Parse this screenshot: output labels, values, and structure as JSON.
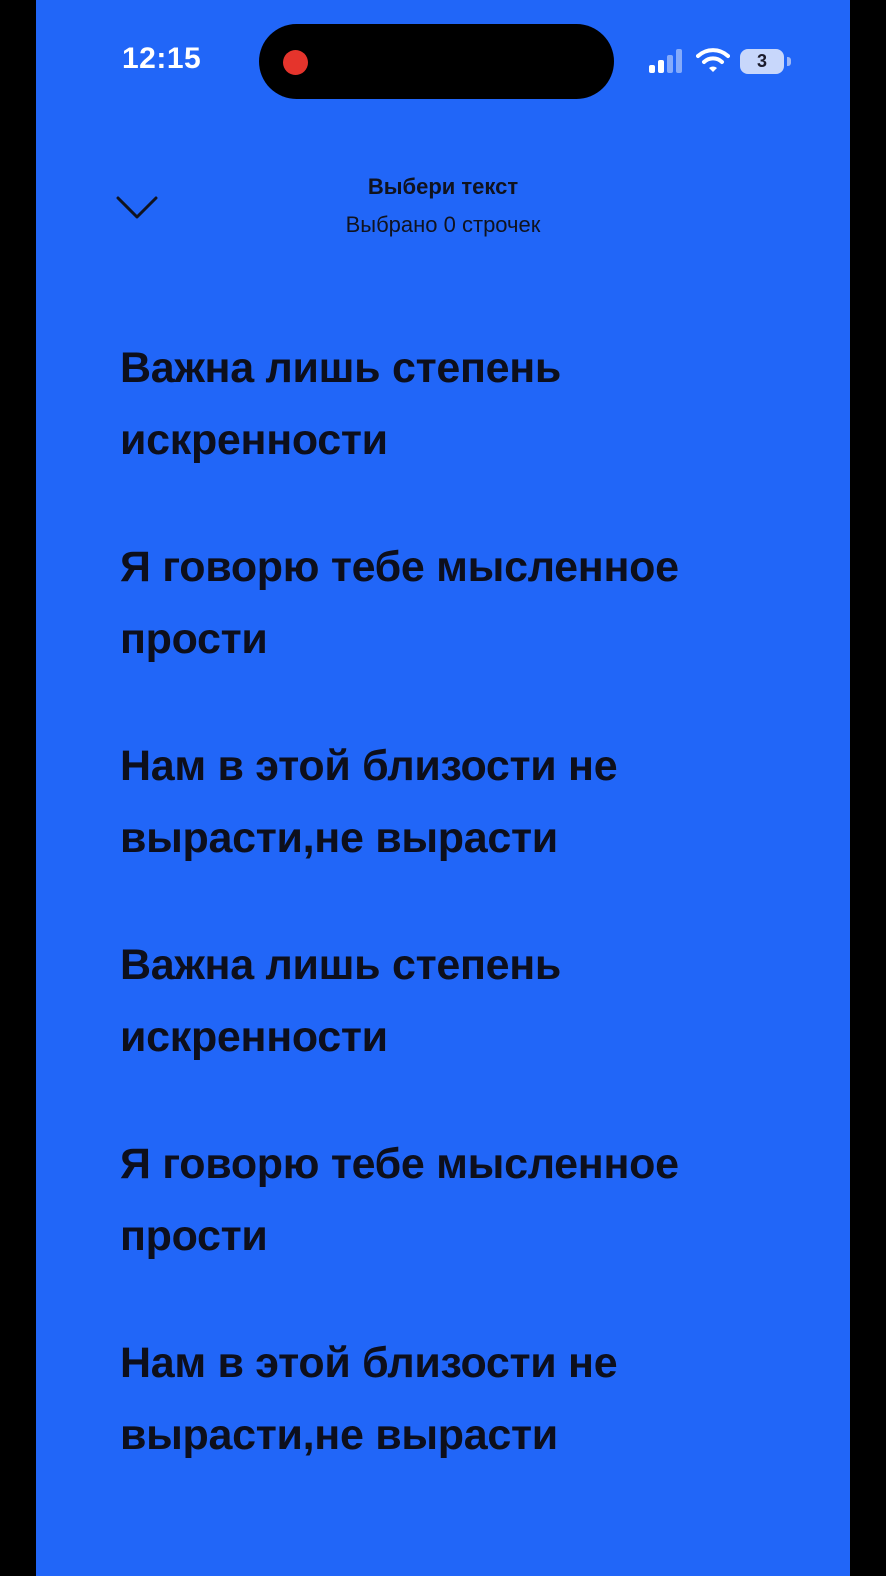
{
  "status_bar": {
    "time": "12:15",
    "battery_level": "3",
    "icons": [
      "recording-indicator-icon",
      "cellular-signal-icon",
      "wifi-icon",
      "battery-icon"
    ]
  },
  "header": {
    "close_icon": "chevron-down-icon",
    "title": "Выбери текст",
    "subtitle": "Выбрано 0 строчек"
  },
  "lyrics": [
    "Важна лишь степень искренности",
    "Я говорю тебе мысленное прости",
    "Нам в этой близости не вырасти,не вырасти",
    "Важна лишь степень искренности",
    "Я говорю тебе мысленное прости",
    "Нам в этой близости не вырасти,не вырасти"
  ],
  "colors": {
    "background": "#2166F8",
    "text": "#0d0f1c",
    "recording": "#E5342C"
  }
}
